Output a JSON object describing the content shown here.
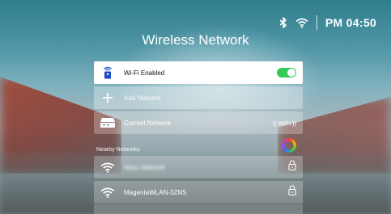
{
  "status_bar": {
    "bluetooth_icon": "bluetooth-icon",
    "wifi_icon": "wifi-icon",
    "clock": "PM 04:50"
  },
  "title": "Wireless Network",
  "wifi_toggle": {
    "label": "Wi-Fi Enabled",
    "state": "on",
    "icon": "wifi-router-icon"
  },
  "add_network": {
    "label": "Add Network",
    "icon": "plus-icon"
  },
  "current_network": {
    "label": "Current Network",
    "value": "(( WiFi ))",
    "icon": "router-icon"
  },
  "nearby": {
    "section_label": "Nearby Networks",
    "networks": [
      {
        "name": "Nanu Network",
        "secured": true,
        "blurred": true
      },
      {
        "name": "MagentaWLAN-3ZNS",
        "secured": true,
        "blurred": false
      }
    ]
  },
  "colors": {
    "toggle_on": "#35c95a",
    "panel_white": "#ffffff"
  }
}
